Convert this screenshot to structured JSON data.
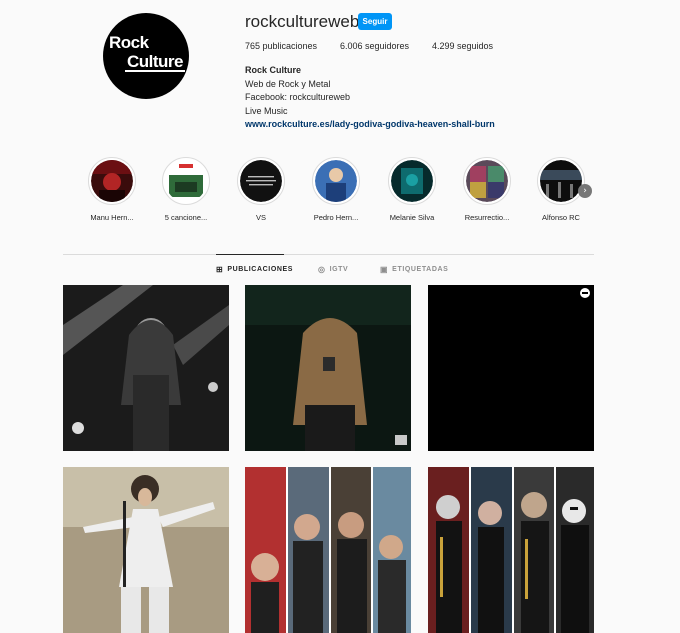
{
  "profile": {
    "avatar_line1": "Rock",
    "avatar_line2": "Culture",
    "username": "rockcultureweb",
    "follow_label": "Seguir",
    "stats": {
      "posts": "765 publicaciones",
      "followers": "6.006 seguidores",
      "following": "4.299 seguidos"
    },
    "bio": {
      "name": "Rock Culture",
      "line1": "Web de Rock y Metal",
      "line2": "Facebook: rockcultureweb",
      "line3": "Live Music",
      "link": "www.rockculture.es/lady-godiva-godiva-heaven-shall-burn"
    }
  },
  "highlights": [
    {
      "label": "Manu Hern..."
    },
    {
      "label": "5 cancione..."
    },
    {
      "label": "VS"
    },
    {
      "label": "Pedro Hern..."
    },
    {
      "label": "Melanie Silva"
    },
    {
      "label": "Resurrectio..."
    },
    {
      "label": "Alfonso RC"
    }
  ],
  "tabs": {
    "posts": "PUBLICACIONES",
    "igtv": "IGTV",
    "tagged": "ETIQUETADAS"
  },
  "icons": {
    "grid": "grid-icon",
    "igtv": "igtv-icon",
    "tagged": "tag-icon",
    "next": "chevron-right-icon",
    "multi": "multi-post-icon"
  },
  "colors": {
    "accent": "#0095f6",
    "link": "#00376b",
    "background": "#fafafa"
  }
}
